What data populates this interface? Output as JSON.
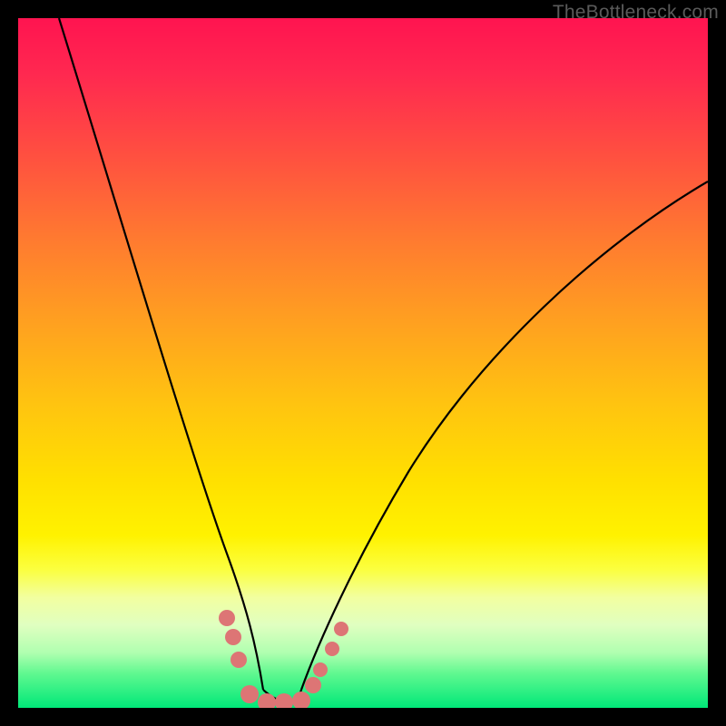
{
  "watermark": "TheBottleneck.com",
  "chart_data": {
    "type": "line",
    "title": "",
    "xlabel": "",
    "ylabel": "",
    "xlim": [
      0,
      100
    ],
    "ylim": [
      0,
      100
    ],
    "series": [
      {
        "name": "curve-left",
        "x": [
          6,
          10,
          14,
          18,
          22,
          26,
          28,
          30,
          32,
          34,
          35.5
        ],
        "y": [
          100,
          84,
          68,
          53,
          39,
          25,
          19,
          13,
          8,
          3,
          0
        ]
      },
      {
        "name": "curve-right",
        "x": [
          41,
          43,
          46,
          50,
          55,
          62,
          70,
          80,
          90,
          100
        ],
        "y": [
          0,
          3,
          8,
          15,
          23,
          34,
          45,
          57,
          67,
          77
        ]
      },
      {
        "name": "flat-bottom",
        "x": [
          35.5,
          41
        ],
        "y": [
          0,
          0
        ]
      }
    ],
    "markers": {
      "name": "pink-dots",
      "color": "#e07070",
      "points": [
        {
          "x": 30.3,
          "y": 13.0
        },
        {
          "x": 31.2,
          "y": 10.2
        },
        {
          "x": 32.0,
          "y": 7.0
        },
        {
          "x": 33.5,
          "y": 2.0
        },
        {
          "x": 36.0,
          "y": 0.8
        },
        {
          "x": 38.5,
          "y": 0.8
        },
        {
          "x": 41.0,
          "y": 1.0
        },
        {
          "x": 42.8,
          "y": 3.2
        },
        {
          "x": 43.8,
          "y": 5.5
        },
        {
          "x": 45.5,
          "y": 8.5
        },
        {
          "x": 46.8,
          "y": 11.5
        }
      ]
    }
  }
}
